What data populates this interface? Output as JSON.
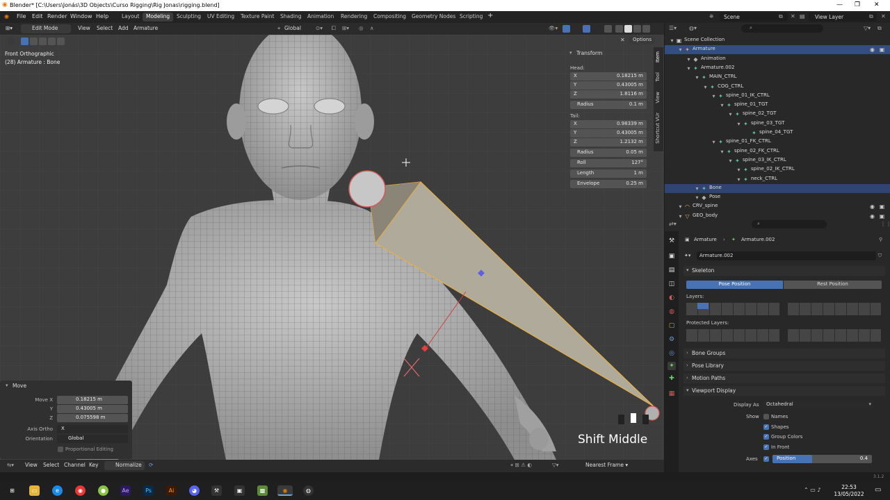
{
  "window": {
    "title": "Blender* [C:\\Users\\Jonás\\3D Objects\\Curso Rigging\\Rig Jonas\\rigging.blend]"
  },
  "menus": [
    "File",
    "Edit",
    "Render",
    "Window",
    "Help"
  ],
  "workspaces": [
    "Layout",
    "Modeling",
    "Sculpting",
    "UV Editing",
    "Texture Paint",
    "Shading",
    "Animation",
    "Rendering",
    "Compositing",
    "Geometry Nodes",
    "Scripting"
  ],
  "active_workspace": "Modeling",
  "scene": {
    "name": "Scene",
    "view_layer": "View Layer"
  },
  "viewport_header": {
    "mode": "Edit Mode",
    "menus": [
      "View",
      "Select",
      "Add",
      "Armature"
    ],
    "orientation": "Global",
    "options": "Options"
  },
  "viewport": {
    "view_name": "Front Orthographic",
    "object_info": "(28) Armature : Bone",
    "key_hint": "Shift Middle"
  },
  "npanel": {
    "section": "Transform",
    "head_label": "Head:",
    "head": [
      {
        "l": "X",
        "v": "0.18215 m"
      },
      {
        "l": "Y",
        "v": "0.43005 m"
      },
      {
        "l": "Z",
        "v": "1.8116 m"
      }
    ],
    "head_radius": {
      "l": "Radius",
      "v": "0.1 m"
    },
    "tail_label": "Tail:",
    "tail": [
      {
        "l": "X",
        "v": "0.98339 m"
      },
      {
        "l": "Y",
        "v": "0.43005 m"
      },
      {
        "l": "Z",
        "v": "1.2132 m"
      }
    ],
    "extra": [
      {
        "l": "Radius",
        "v": "0.05 m"
      },
      {
        "l": "Roll",
        "v": "127°"
      },
      {
        "l": "Length",
        "v": "1 m"
      },
      {
        "l": "Envelope",
        "v": "0.25 m"
      }
    ],
    "tabs": [
      "Item",
      "Tool",
      "View",
      "Shortcut VUr"
    ]
  },
  "operator": {
    "title": "Move",
    "fields": [
      {
        "l": "Move X",
        "v": "0.18215 m"
      },
      {
        "l": "Y",
        "v": "0.43005 m"
      },
      {
        "l": "Z",
        "v": "0.075598 m"
      }
    ],
    "axis_ortho": {
      "l": "Axis Ortho",
      "v": "X"
    },
    "orientation": {
      "l": "Orientation",
      "v": "Global"
    },
    "proportional": "Proportional Editing"
  },
  "timeline": {
    "menus": [
      "View",
      "Select",
      "Channel",
      "Key"
    ],
    "normalize": "Normalize",
    "snap": "Nearest Frame"
  },
  "outliner": {
    "rows": [
      {
        "t": "Scene Collection",
        "d": 0,
        "ico": "▣",
        "c": "#d0d0d0"
      },
      {
        "t": "Armature",
        "d": 1,
        "ico": "✦",
        "c": "#e0a060",
        "sel": true
      },
      {
        "t": "Animation",
        "d": 2,
        "ico": "◆",
        "c": "#b0b0b0"
      },
      {
        "t": "Armature.002",
        "d": 2,
        "ico": "✦",
        "c": "#60c0a0"
      },
      {
        "t": "MAIN_CTRL",
        "d": 3,
        "ico": "✦",
        "c": "#60c0a0"
      },
      {
        "t": "COG_CTRL",
        "d": 4,
        "ico": "✦",
        "c": "#60c0a0"
      },
      {
        "t": "spine_01_IK_CTRL",
        "d": 5,
        "ico": "✦",
        "c": "#60c0a0"
      },
      {
        "t": "spine_01_TGT",
        "d": 6,
        "ico": "✦",
        "c": "#60c0a0"
      },
      {
        "t": "spine_02_TGT",
        "d": 7,
        "ico": "✦",
        "c": "#60c0a0"
      },
      {
        "t": "spine_03_TGT",
        "d": 8,
        "ico": "✦",
        "c": "#60c0a0"
      },
      {
        "t": "spine_04_TGT",
        "d": 9,
        "ico": "✦",
        "c": "#60c0a0"
      },
      {
        "t": "spine_01_FK_CTRL",
        "d": 5,
        "ico": "✦",
        "c": "#60c0a0"
      },
      {
        "t": "spine_02_FK_CTRL",
        "d": 6,
        "ico": "✦",
        "c": "#60c0a0"
      },
      {
        "t": "spine_03_IK_CTRL",
        "d": 7,
        "ico": "✦",
        "c": "#60c0a0"
      },
      {
        "t": "spine_02_IK_CTRL",
        "d": 8,
        "ico": "✦",
        "c": "#60c0a0"
      },
      {
        "t": "neck_CTRL",
        "d": 8,
        "ico": "✦",
        "c": "#60c0a0"
      },
      {
        "t": "Bone",
        "d": 3,
        "ico": "✦",
        "c": "#60c0a0",
        "sel2": true
      },
      {
        "t": "Pose",
        "d": 3,
        "ico": "◆",
        "c": "#b0b0b0"
      },
      {
        "t": "CRV_spine",
        "d": 1,
        "ico": "◠",
        "c": "#e0a060"
      },
      {
        "t": "GEO_body",
        "d": 1,
        "ico": "▽",
        "c": "#e0a060"
      }
    ]
  },
  "properties": {
    "breadcrumb": [
      "Armature",
      "Armature.002"
    ],
    "data_name": "Armature.002",
    "skeleton": "Skeleton",
    "pose_position": "Pose Position",
    "rest_position": "Rest Position",
    "layers": "Layers:",
    "protected_layers": "Protected Layers:",
    "sections": [
      "Bone Groups",
      "Pose Library",
      "Motion Paths",
      "Viewport Display"
    ],
    "display_as": {
      "l": "Display As",
      "v": "Octahedral"
    },
    "show": "Show",
    "names": "Names",
    "checks": [
      "Shapes",
      "Group Colors",
      "In Front"
    ],
    "axes": {
      "l": "Axes",
      "v": "Position",
      "n": "0.4"
    },
    "version": "3.1.2"
  },
  "taskbar": {
    "time": "22:53",
    "date": "13/05/2022"
  }
}
